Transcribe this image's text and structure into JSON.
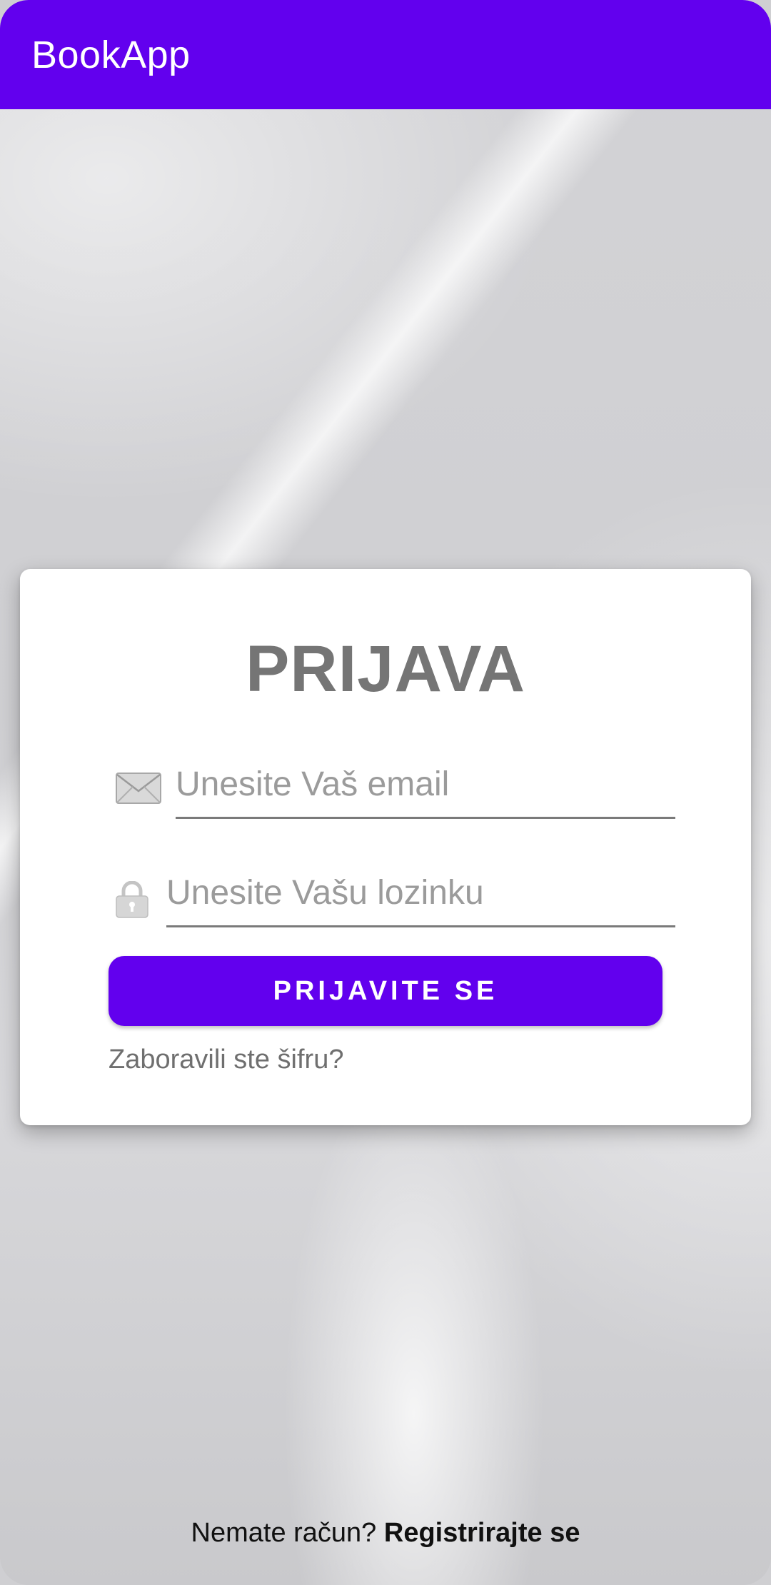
{
  "app_bar": {
    "title": "BookApp"
  },
  "login_card": {
    "title": "PRIJAVA",
    "email": {
      "icon": "envelope-icon",
      "placeholder": "Unesite Vaš email",
      "value": ""
    },
    "password": {
      "icon": "lock-icon",
      "placeholder": "Unesite Vašu lozinku",
      "value": ""
    },
    "login_button_label": "PRIJAVITE SE",
    "forgot_password_label": "Zaboravili ste šifru?"
  },
  "footer": {
    "prompt": "Nemate račun?",
    "register_label": "Registrirajte se"
  },
  "colors": {
    "primary": "#6200ee",
    "title_gray": "#757575",
    "placeholder_gray": "#9b9b9b",
    "card_background": "#ffffff"
  }
}
